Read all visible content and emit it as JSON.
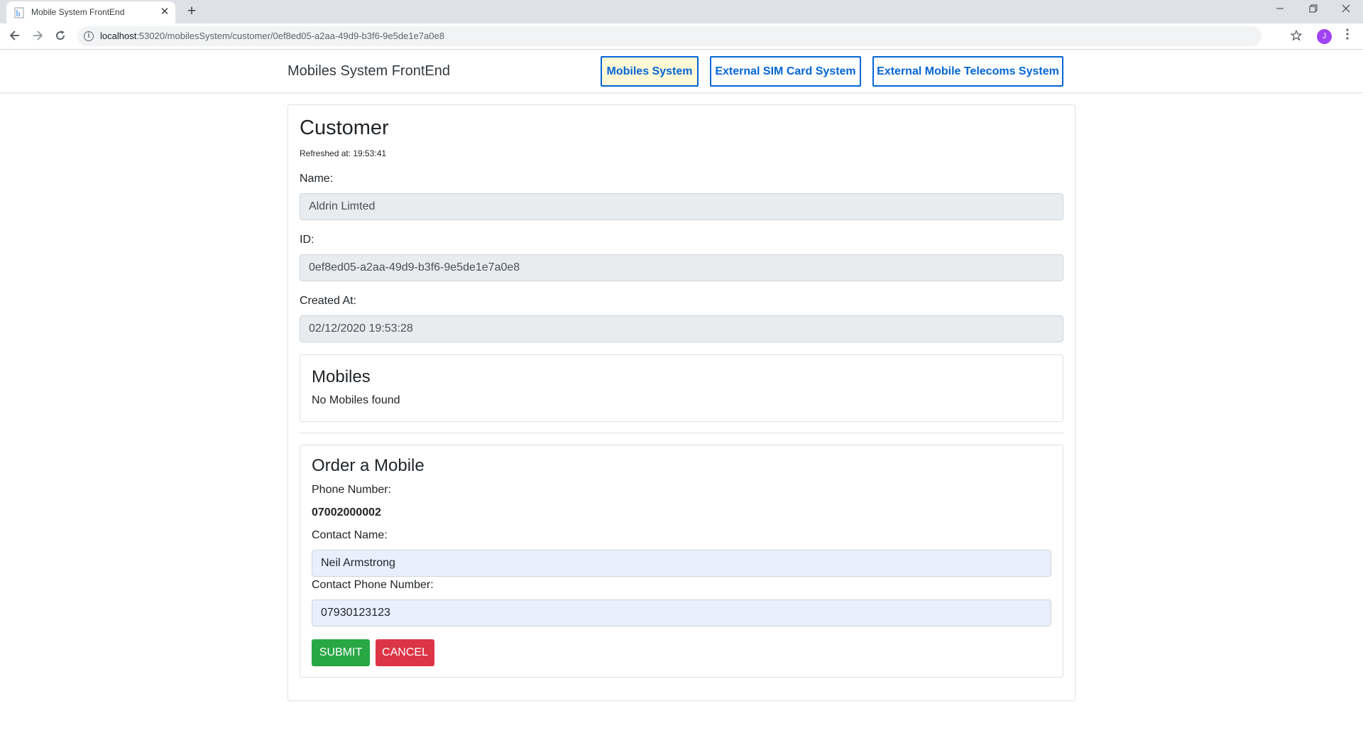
{
  "browser": {
    "tab_title": "Mobile System FrontEnd",
    "tab_close": "✕",
    "new_tab": "+",
    "url_host": "localhost",
    "url_path": ":53020/mobilesSystem/customer/0ef8ed05-a2aa-49d9-b3f6-9e5de1e7a0e8",
    "avatar_letter": "J",
    "icons": [
      "back-icon",
      "forward-icon",
      "reload-icon",
      "info-icon",
      "star-icon",
      "menu-icon",
      "minimize-icon",
      "restore-icon",
      "close-icon"
    ]
  },
  "navbar": {
    "brand": "Mobiles System FrontEnd",
    "links": [
      {
        "label": "Mobiles System",
        "active": true
      },
      {
        "label": "External SIM Card System",
        "active": false
      },
      {
        "label": "External Mobile Telecoms System",
        "active": false
      }
    ],
    "accent_color": "#0366d6"
  },
  "customer": {
    "title": "Customer",
    "refreshed": "Refreshed at: 19:53:41",
    "name_label": "Name:",
    "name_value": "Aldrin Limted",
    "id_label": "ID:",
    "id_value": "0ef8ed05-a2aa-49d9-b3f6-9e5de1e7a0e8",
    "created_label": "Created At:",
    "created_value": "02/12/2020 19:53:28"
  },
  "mobiles": {
    "title": "Mobiles",
    "empty_text": "No Mobiles found"
  },
  "order": {
    "title": "Order a Mobile",
    "phone_label": "Phone Number:",
    "phone_value": "07002000002",
    "contact_name_label": "Contact Name:",
    "contact_name_value": "Neil Armstrong",
    "contact_phone_label": "Contact Phone Number:",
    "contact_phone_value": "07930123123",
    "submit_label": "Submit",
    "cancel_label": "Cancel",
    "submit_color": "#28a745",
    "cancel_color": "#dc3545"
  }
}
